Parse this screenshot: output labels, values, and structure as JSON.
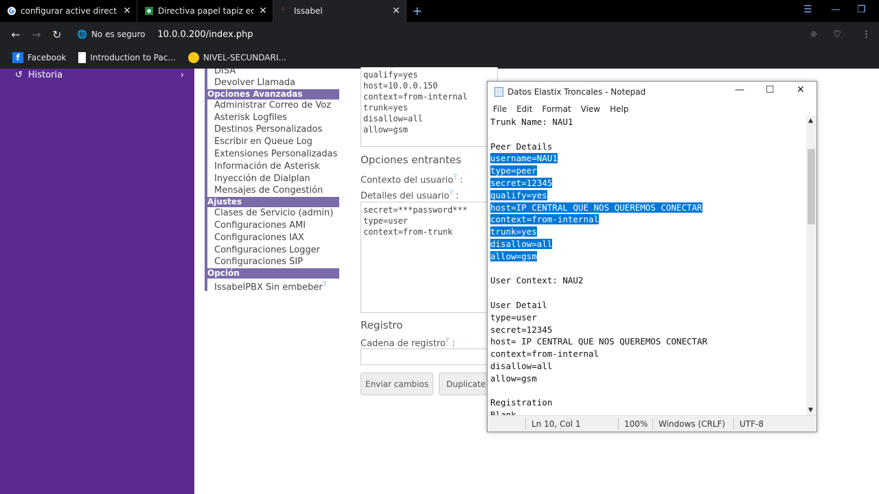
{
  "browser": {
    "tabs": [
      {
        "title": "configurar active directory",
        "icon": "google-icon"
      },
      {
        "title": "Directiva papel tapiz equip",
        "icon": "wallpaper-icon"
      },
      {
        "title": "Issabel",
        "icon": "issabel-icon"
      }
    ],
    "security_label": "No es seguro",
    "url": "10.0.0.200/index.php",
    "bookmarks": [
      "Facebook",
      "Introduction to Pac...",
      "NIVEL-SECUNDARI..."
    ]
  },
  "sidebar": {
    "historia": "Historia"
  },
  "menu": {
    "top_items": [
      "DISA",
      "Devolver Llamada"
    ],
    "section_avanzadas": "Opciones Avanzadas",
    "avanzadas": [
      "Administrar Correo de Voz",
      "Asterisk Logfiles",
      "Destinos Personalizados",
      "Escribir en Queue Log",
      "Extensiones Personalizadas",
      "Información de Asterisk",
      "Inyección de Dialplan",
      "Mensajes de Congestión"
    ],
    "section_ajustes": "Ajustes",
    "ajustes": [
      "Clases de Servicio (admin)",
      "Configuraciones AMI",
      "Configuraciones IAX",
      "Configuraciones Logger",
      "Configuraciones SIP"
    ],
    "section_opcion": "Opción",
    "opcion": [
      "IssabelPBX Sin embeber"
    ]
  },
  "form": {
    "peer_text": "qualify=yes\nhost=10.0.0.150\ncontext=from-internal\ntrunk=yes\ndisallow=all\nallow=gsm",
    "incoming_header": "Opciones entrantes",
    "user_context_label": "Contexto del usuario",
    "user_details_label": "Detalles del usuario",
    "user_text": "secret=***password***\ntype=user\ncontext=from-trunk",
    "registro_header": "Registro",
    "registro_label": "Cadena de registro",
    "submit_label": "Enviar cambios",
    "duplicate_label": "Duplicate T"
  },
  "notepad": {
    "title": "Datos Elastix Troncales - Notepad",
    "menu": [
      "File",
      "Edit",
      "Format",
      "View",
      "Help"
    ],
    "lines": [
      {
        "t": "Trunk Name: NAU1",
        "s": false
      },
      {
        "t": "",
        "s": false
      },
      {
        "t": "Peer Details",
        "s": false
      },
      {
        "t": "username=NAU1",
        "s": true
      },
      {
        "t": "type=peer",
        "s": true
      },
      {
        "t": "secret=12345",
        "s": true
      },
      {
        "t": "qualify=yes",
        "s": true
      },
      {
        "t": "host=IP CENTRAL QUE NOS QUEREMOS CONECTAR",
        "s": true
      },
      {
        "t": "context=from-internal",
        "s": true
      },
      {
        "t": "trunk=yes",
        "s": true
      },
      {
        "t": "disallow=all",
        "s": true
      },
      {
        "t": "allow=gsm",
        "s": true
      },
      {
        "t": "",
        "s": false
      },
      {
        "t": "User Context: NAU2",
        "s": false
      },
      {
        "t": "",
        "s": false
      },
      {
        "t": "User Detail",
        "s": false
      },
      {
        "t": "type=user",
        "s": false
      },
      {
        "t": "secret=12345",
        "s": false
      },
      {
        "t": "host= IP CENTRAL QUE NOS QUEREMOS CONECTAR",
        "s": false
      },
      {
        "t": "context=from-internal",
        "s": false
      },
      {
        "t": "disallow=all",
        "s": false
      },
      {
        "t": "allow=gsm",
        "s": false
      },
      {
        "t": "",
        "s": false
      },
      {
        "t": "Registration",
        "s": false
      },
      {
        "t": "Blank",
        "s": false
      }
    ],
    "status": {
      "position": "Ln 10, Col 1",
      "zoom": "100%",
      "eol": "Windows (CRLF)",
      "encoding": "UTF-8"
    }
  },
  "colors": {
    "sidebar": "#5a2a8f",
    "selection": "#0078d7",
    "menu_accent": "#7b6bab"
  }
}
